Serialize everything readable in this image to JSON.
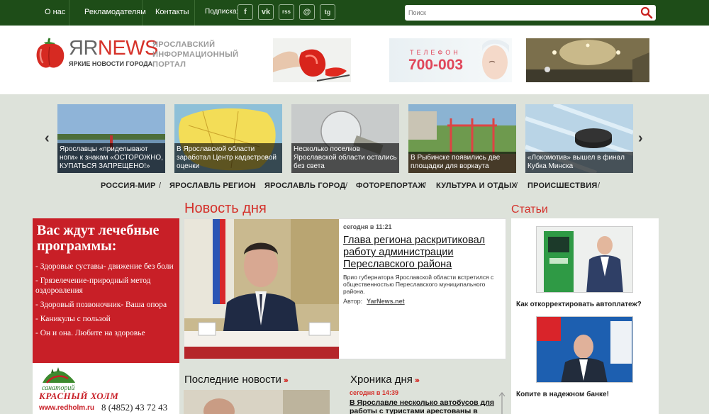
{
  "topbar": {
    "links": [
      "О нас",
      "Рекламодателям",
      "Контакты"
    ],
    "subscribe_label": "Подписка:",
    "social": [
      {
        "icon": "facebook-icon",
        "glyph": "f"
      },
      {
        "icon": "vk-icon",
        "glyph": "vk"
      },
      {
        "icon": "rss-icon",
        "glyph": "rss"
      },
      {
        "icon": "email-icon",
        "glyph": "@"
      },
      {
        "icon": "telegram-icon",
        "glyph": "tg"
      }
    ],
    "search_placeholder": "Поиск"
  },
  "header": {
    "logo_part1": "ЯR",
    "logo_part2": "NEWS",
    "tagline": "ЯРКИЕ НОВОСТИ ГОРОДА",
    "desc_lines": [
      "ЯРОСЛАВСКИЙ",
      "ИНФОРМАЦИОННЫЙ",
      "ПОРТАЛ"
    ],
    "ad2_line1": "ТЕЛЕФОН",
    "ad2_line2": "700-003"
  },
  "carousel": [
    "Ярославцы «приделывают ноги» к знакам «ОСТОРОЖНО, КУПАТЬСЯ ЗАПРЕЩЕНО!»",
    "В Ярославской области заработал Центр кадастровой оценки",
    "Несколько поселков Ярославской области остались без света",
    "В Рыбинске появились две площадки для воркаута",
    "«Локомотив» вышел в финал Кубка Минска"
  ],
  "nav": [
    "РОССИЯ-МИР",
    "ЯРОСЛАВЛЬ РЕГИОН",
    "ЯРОСЛАВЛЬ ГОРОД",
    "ФОТОРЕПОРТАЖ",
    "КУЛЬТУРА И ОТДЫХ",
    "ПРОИСШЕСТВИЯ"
  ],
  "banner": {
    "title": "Вас ждут лечебные программы:",
    "items": [
      "- Здоровые суставы- движение без боли",
      "- Грязелечение-природный метод оздоровления",
      "- Здоровый позвоночник- Ваша опора",
      "- Каникулы с пользой",
      "- Он и она. Любите на здоровье"
    ],
    "sanatorium": "санаторий",
    "name": "КРАСНЫЙ ХОЛМ",
    "site": "www.redholm.ru",
    "phone": "8 (4852) 43 72 43"
  },
  "news_of_day": {
    "section_title": "Новость дня",
    "time": "сегодня в 11:21",
    "headline": "Глава региона раскритиковал работу администрации Переславского района",
    "lead": "Врио губернатора Ярославской области встретился с общественностью Переславского муниципального района.",
    "author_label": "Автор:",
    "author": "YarNews.net"
  },
  "latest": {
    "title": "Последние новости"
  },
  "chronicle": {
    "title": "Хроника дня",
    "time": "сегодня в 14:39",
    "item": "В Ярославле несколько автобусов для работы с туристами арестованы в"
  },
  "articles": {
    "title": "Статьи",
    "items": [
      "Как откорректировать автоплатеж?",
      "Копите в надежном банке!"
    ]
  }
}
